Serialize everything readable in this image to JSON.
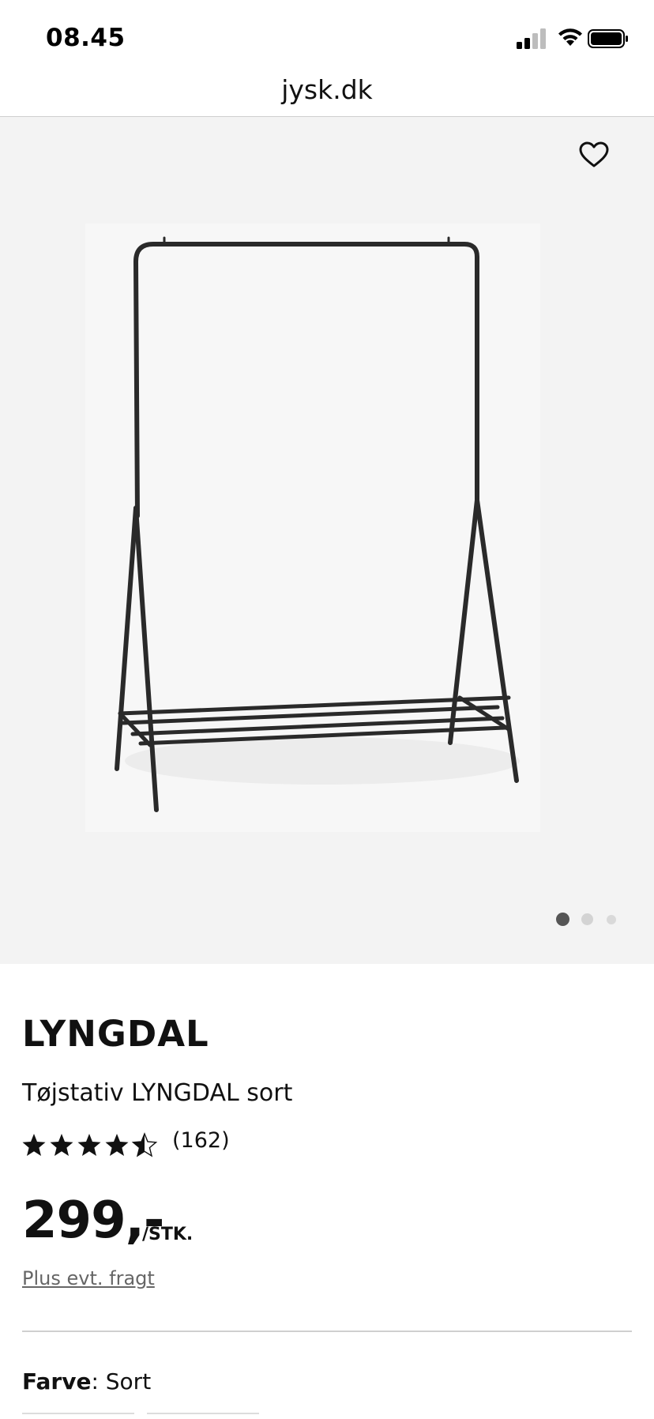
{
  "status_bar": {
    "time": "08.45",
    "icons": [
      "signal-icon",
      "wifi-icon",
      "battery-icon"
    ]
  },
  "browser": {
    "url": "jysk.dk"
  },
  "gallery": {
    "image_alt": "Tøjstativ LYNGDAL sort",
    "active_slide": 1,
    "total_slides": 3,
    "wishlist_icon": "heart-icon"
  },
  "product": {
    "brand": "LYNGDAL",
    "name": "Tøjstativ LYNGDAL sort",
    "rating": 4.5,
    "rating_max": 5,
    "review_count": "(162)",
    "price": "299,-",
    "price_unit": "/STK.",
    "shipping_note": "Plus evt. fragt",
    "color_label": "Farve",
    "color_value": "Sort"
  },
  "colors": {
    "text": "#111111",
    "gallery_bg": "#f3f3f3",
    "muted_link": "#666666",
    "dot_active": "#555555",
    "dot_inactive": "#d3d3d3"
  }
}
